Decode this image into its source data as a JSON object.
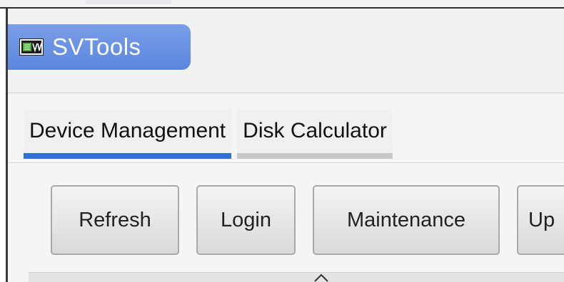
{
  "window": {
    "title": "SVTools",
    "icon": "sv-app-icon"
  },
  "tabs": [
    {
      "label": "Device Management",
      "active": true
    },
    {
      "label": "Disk Calculator",
      "active": false
    }
  ],
  "toolbar": {
    "refresh_label": "Refresh",
    "login_label": "Login",
    "maintenance_label": "Maintenance",
    "upgrade_label_visible": "Up"
  },
  "list": {
    "sort_indicator": "chevron-up-icon"
  },
  "colors": {
    "title_bg": "#5b86de",
    "active_tab_underline": "#2e6fd8",
    "inactive_tab_underline": "#c8c8c8"
  }
}
